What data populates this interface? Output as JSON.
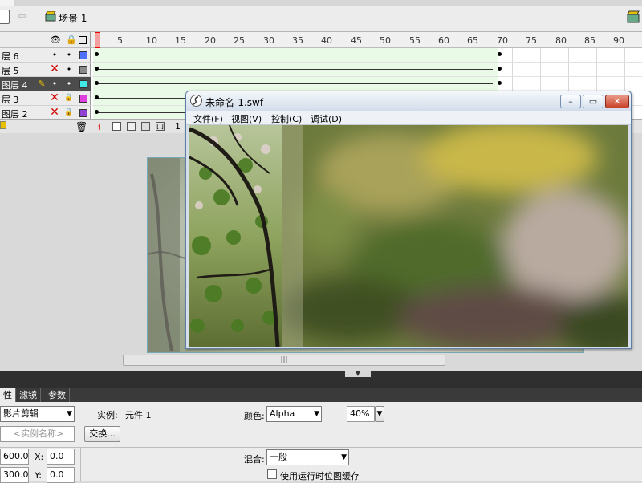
{
  "scene": {
    "label": "场景 1"
  },
  "timeline": {
    "ruler_ticks": [
      "1",
      "5",
      "10",
      "15",
      "20",
      "25",
      "30",
      "35",
      "40",
      "45",
      "50",
      "55",
      "60",
      "65",
      "70",
      "75",
      "80",
      "85",
      "90"
    ],
    "layers": [
      {
        "name": "层 6",
        "hidden": false,
        "locked": false,
        "color": "#4f6fff",
        "selected": false
      },
      {
        "name": "层 5",
        "hidden": true,
        "locked": false,
        "color": "#8a8a8a",
        "selected": false
      },
      {
        "name": "图层 4",
        "hidden": false,
        "locked": false,
        "color": "#40e8e8",
        "selected": true
      },
      {
        "name": "层 3",
        "hidden": true,
        "locked": true,
        "color": "#e040e0",
        "selected": false
      },
      {
        "name": "图层 2",
        "hidden": true,
        "locked": true,
        "color": "#9040d0",
        "selected": false
      }
    ],
    "current_frame": "1"
  },
  "swf": {
    "title": "未命名-1.swf",
    "menus": [
      "文件(F)",
      "视图(V)",
      "控制(C)",
      "调试(D)"
    ],
    "minimize": "–",
    "maximize": "▭",
    "close": "✕"
  },
  "stage": {
    "scroll_grip": "|||"
  },
  "properties": {
    "tabs": [
      "性",
      "滤镜",
      "参数"
    ],
    "symbol_type": "影片剪辑",
    "instance_label": "实例:",
    "instance_value": "元件 1",
    "instance_name_placeholder": "<实例名称>",
    "swap_button": "交换...",
    "color_label": "颜色:",
    "color_value": "Alpha",
    "alpha_value": "40%",
    "width_value": "600.0",
    "height_value": "300.0",
    "x_label": "X:",
    "x_value": "0.0",
    "y_label": "Y:",
    "y_value": "0.0",
    "blend_label": "混合:",
    "blend_value": "一般",
    "cache_label": "使用运行时位图缓存"
  }
}
